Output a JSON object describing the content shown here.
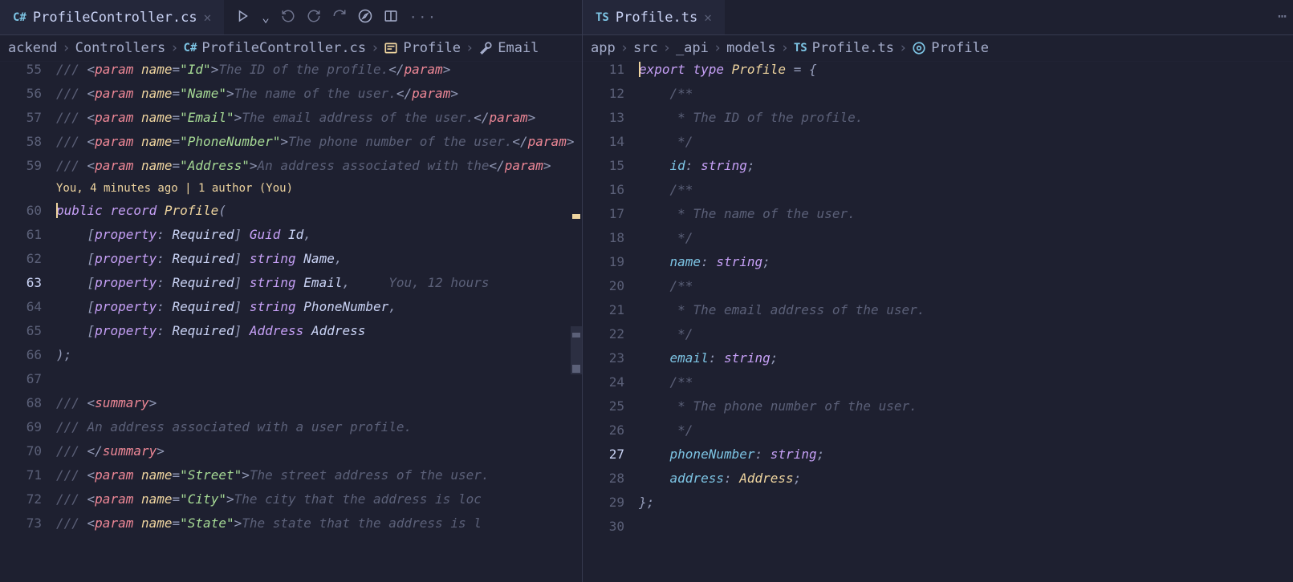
{
  "left": {
    "tab": {
      "icon": "C#",
      "title": "ProfileController.cs"
    },
    "breadcrumbs": [
      "ackend",
      "Controllers",
      "ProfileController.cs",
      "Profile",
      "Email"
    ],
    "codelens": "You, 4 minutes ago | 1 author (You)",
    "lines": [
      {
        "n": 55,
        "kind": "param",
        "name": "Id",
        "desc": "The ID of the profile."
      },
      {
        "n": 56,
        "kind": "param",
        "name": "Name",
        "desc": "The name of the user."
      },
      {
        "n": 57,
        "kind": "param",
        "name": "Email",
        "desc": "The email address of the user."
      },
      {
        "n": 58,
        "kind": "param",
        "name": "PhoneNumber",
        "desc": "The phone number of the user."
      },
      {
        "n": 59,
        "kind": "param",
        "name": "Address",
        "desc": "An address associated with the"
      }
    ],
    "recordDecl": {
      "n": 60,
      "text_kw": "public record",
      "text_name": "Profile"
    },
    "props": [
      {
        "n": 61,
        "type": "Guid",
        "name": "Id",
        "comma": true
      },
      {
        "n": 62,
        "type": "string",
        "name": "Name",
        "comma": true,
        "bulb": true
      },
      {
        "n": 63,
        "type": "string",
        "name": "Email",
        "comma": true,
        "active": true,
        "ghost": "You, 12 hours"
      },
      {
        "n": 64,
        "type": "string",
        "name": "PhoneNumber",
        "comma": true
      },
      {
        "n": 65,
        "type": "Address",
        "name": "Address",
        "comma": false
      }
    ],
    "closeParen": {
      "n": 66
    },
    "blank": {
      "n": 67
    },
    "summaryOpen": {
      "n": 68
    },
    "summaryText": {
      "n": 69,
      "text": "An address associated with a user profile."
    },
    "summaryClose": {
      "n": 70
    },
    "params2": [
      {
        "n": 71,
        "name": "Street",
        "desc": "The street address of the user."
      },
      {
        "n": 72,
        "name": "City",
        "desc": "The city that the address is loc"
      },
      {
        "n": 73,
        "name": "State",
        "desc": "The state that the address is l"
      }
    ]
  },
  "right": {
    "tab": {
      "icon": "TS",
      "title": "Profile.ts"
    },
    "breadcrumbs": [
      "app",
      "src",
      "_api",
      "models",
      "Profile.ts",
      "Profile"
    ],
    "typeDecl": {
      "n": 11,
      "kw1": "export",
      "kw2": "type",
      "name": "Profile"
    },
    "fields": [
      {
        "doc": "The ID of the profile.",
        "name": "id",
        "type": "string",
        "n_doc1": 12,
        "n_doc2": 13,
        "n_doc3": 14,
        "n_field": 15
      },
      {
        "doc": "The name of the user.",
        "name": "name",
        "type": "string",
        "n_doc1": 16,
        "n_doc2": 17,
        "n_doc3": 18,
        "n_field": 19
      },
      {
        "doc": "The email address of the user.",
        "name": "email",
        "type": "string",
        "n_doc1": 20,
        "n_doc2": 21,
        "n_doc3": 22,
        "n_field": 23
      },
      {
        "doc": "The phone number of the user.",
        "name": "phoneNumber",
        "type": "string",
        "n_doc1": 24,
        "n_doc2": 25,
        "n_doc3": 26,
        "n_field": 27,
        "bulb": true,
        "active": true
      }
    ],
    "addressField": {
      "n": 28,
      "name": "address",
      "type": "Address"
    },
    "close": {
      "n": 29
    },
    "tail": {
      "n": 30
    }
  },
  "labels": {
    "property": "property",
    "required": "Required",
    "summary": "summary",
    "param": "param",
    "name_attr": "name",
    "doc_open": "/**",
    "doc_mid": " * ",
    "doc_close": " */"
  }
}
